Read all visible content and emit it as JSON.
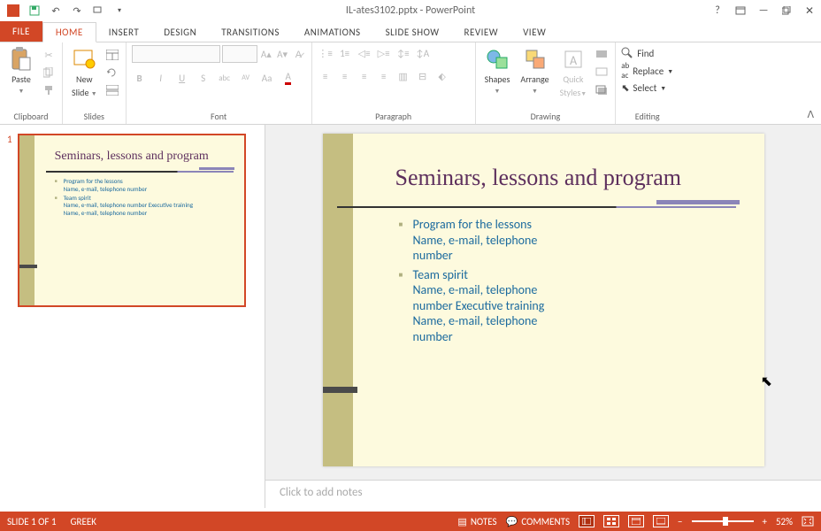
{
  "title": {
    "filename": "IL-ates3102.pptx",
    "app": "PowerPoint"
  },
  "tabs": {
    "file": "FILE",
    "home": "HOME",
    "insert": "INSERT",
    "design": "DESIGN",
    "transitions": "TRANSITIONS",
    "animations": "ANIMATIONS",
    "slideshow": "SLIDE SHOW",
    "review": "REVIEW",
    "view": "VIEW"
  },
  "ribbon": {
    "clipboard": {
      "paste": "Paste",
      "label": "Clipboard"
    },
    "slides": {
      "new_slide": "New",
      "new_slide2": "Slide",
      "label": "Slides"
    },
    "font": {
      "label": "Font"
    },
    "paragraph": {
      "label": "Paragraph"
    },
    "drawing": {
      "shapes": "Shapes",
      "arrange": "Arrange",
      "quick": "Quick",
      "styles": "Styles",
      "label": "Drawing"
    },
    "editing": {
      "find": "Find",
      "replace": "Replace",
      "select": "Select",
      "label": "Editing"
    }
  },
  "slide": {
    "number": "1",
    "title": "Seminars, lessons and program",
    "bullets": [
      {
        "head": "Program for the lessons",
        "lines": [
          "Name, e-mail, telephone number"
        ]
      },
      {
        "head": "Team spirit",
        "lines": [
          "Name, e-mail, telephone number Executive training",
          "Name, e-mail, telephone number"
        ]
      }
    ]
  },
  "notes": {
    "placeholder": "Click to add notes"
  },
  "status": {
    "slide_of": "SLIDE 1 OF 1",
    "lang": "GREEK",
    "notes": "NOTES",
    "comments": "COMMENTS",
    "zoom": "52%"
  }
}
